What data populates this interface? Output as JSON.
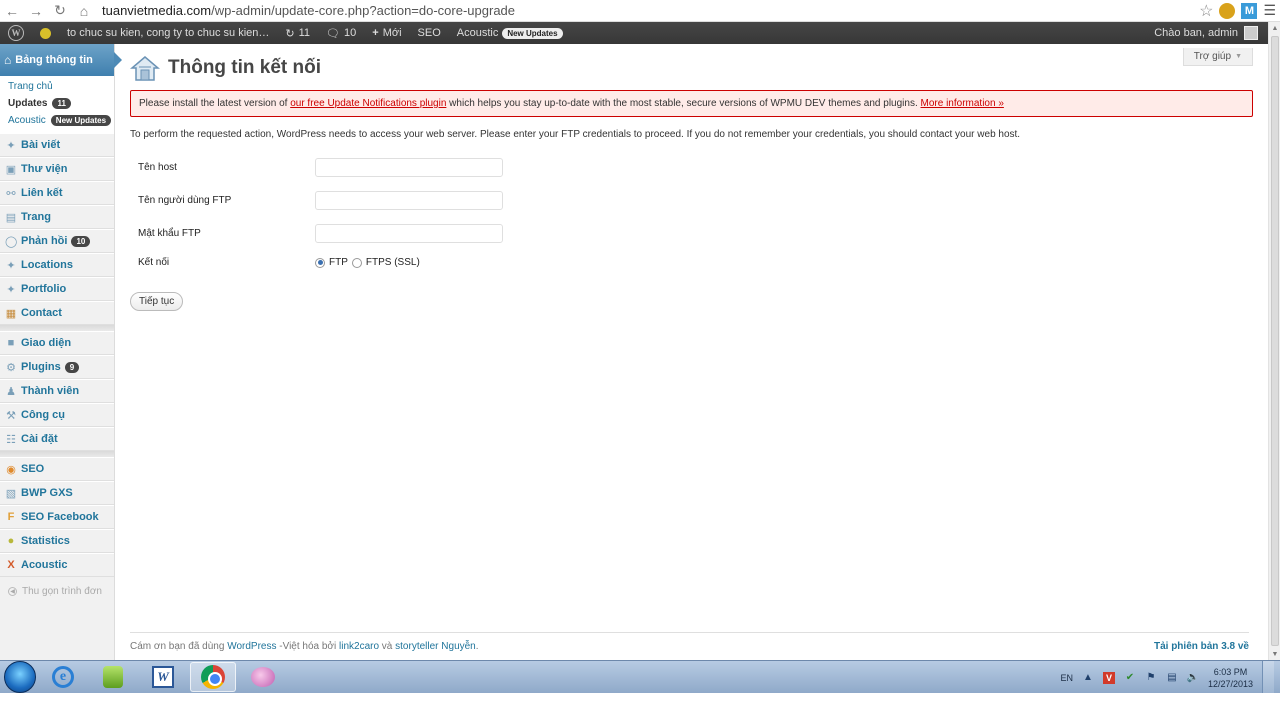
{
  "browser": {
    "url_host": "tuanvietmedia.com",
    "url_path": "/wp-admin/update-core.php?action=do-core-upgrade"
  },
  "adminbar": {
    "site_name": "to chuc su kien, cong ty to chuc su kien…",
    "updates_count": "11",
    "comments_count": "10",
    "new_label": "Mới",
    "seo_label": "SEO",
    "acoustic_label": "Acoustic",
    "new_updates_pill": "New Updates",
    "greeting": "Chào ban, admin"
  },
  "sidebar": {
    "dashboard_label": "Bảng thông tin",
    "submenu": [
      {
        "label": "Trang chủ"
      },
      {
        "label": "Updates",
        "badge": "11"
      },
      {
        "label": "Acoustic",
        "badge": "New Updates"
      }
    ],
    "group1": [
      {
        "label": "Bài viết",
        "icon": "pin-icon"
      },
      {
        "label": "Thư viện",
        "icon": "media-icon"
      },
      {
        "label": "Liên kết",
        "icon": "link-icon"
      },
      {
        "label": "Trang",
        "icon": "page-icon"
      },
      {
        "label": "Phản hồi",
        "icon": "comment-icon",
        "badge": "10"
      },
      {
        "label": "Locations",
        "icon": "pin-icon"
      },
      {
        "label": "Portfolio",
        "icon": "pin-icon"
      },
      {
        "label": "Contact",
        "icon": "form-icon"
      }
    ],
    "group2": [
      {
        "label": "Giao diện",
        "icon": "appearance-icon"
      },
      {
        "label": "Plugins",
        "icon": "plugin-icon",
        "badge": "9"
      },
      {
        "label": "Thành viên",
        "icon": "users-icon"
      },
      {
        "label": "Công cụ",
        "icon": "tools-icon"
      },
      {
        "label": "Cài đặt",
        "icon": "settings-icon"
      }
    ],
    "group3": [
      {
        "label": "SEO",
        "icon": "seo-icon"
      },
      {
        "label": "BWP GXS",
        "icon": "sitemap-icon"
      },
      {
        "label": "SEO Facebook",
        "icon": "facebook-icon"
      },
      {
        "label": "Statistics",
        "icon": "stats-icon"
      },
      {
        "label": "Acoustic",
        "icon": "acoustic-icon"
      }
    ],
    "collapse_label": "Thu gọn trình đơn"
  },
  "content": {
    "help_label": "Trợ giúp",
    "page_title": "Thông tin kết nối",
    "notice": {
      "before": "Please install the latest version of ",
      "link1": "our free Update Notifications plugin",
      "middle": " which helps you stay up-to-date with the most stable, secure versions of WPMU DEV themes and plugins. ",
      "link2": "More information »"
    },
    "intro": "To perform the requested action, WordPress needs to access your web server. Please enter your FTP credentials to proceed. If you do not remember your credentials, you should contact your web host.",
    "fields": {
      "host_label": "Tên host",
      "host_value": "",
      "user_label": "Tên người dùng FTP",
      "user_value": "",
      "pass_label": "Mật khẩu FTP",
      "pass_value": "",
      "conn_label": "Kết nối",
      "opt_ftp": "FTP",
      "opt_ftps": "FTPS (SSL)",
      "selected": "FTP"
    },
    "submit_label": "Tiếp tục",
    "footer": {
      "thanks": "Cám ơn bạn đã dùng ",
      "wordpress": "WordPress",
      "viet": " -Việt hóa bởi ",
      "link2caro": "link2caro",
      "and": " và ",
      "storyteller": "storyteller Nguyễn",
      "dot": ".",
      "version": "Tải phiên bản 3.8 về"
    }
  },
  "taskbar": {
    "lang": "EN",
    "time": "6:03 PM",
    "date": "12/27/2013"
  }
}
